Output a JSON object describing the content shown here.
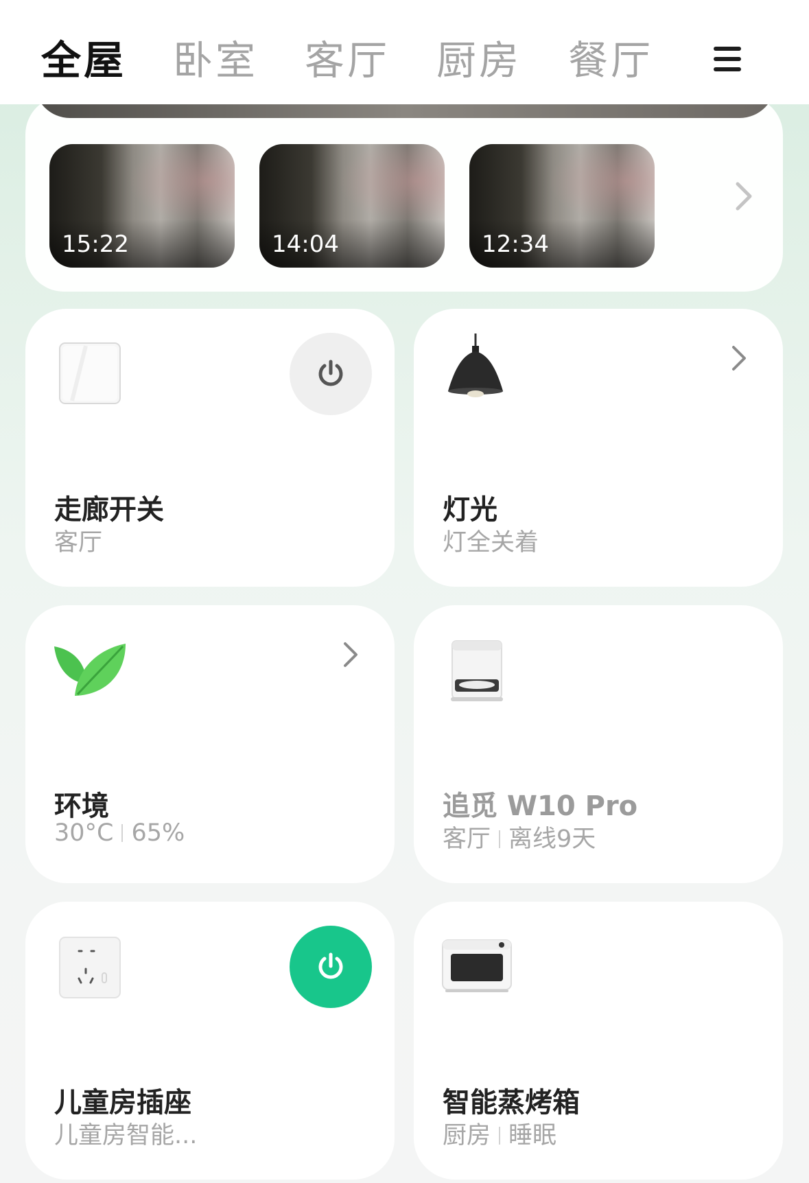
{
  "tabs": [
    {
      "label": "全屋",
      "active": true
    },
    {
      "label": "卧室",
      "active": false
    },
    {
      "label": "客厅",
      "active": false
    },
    {
      "label": "厨房",
      "active": false
    },
    {
      "label": "餐厅",
      "active": false
    }
  ],
  "menu_icon": "hamburger-menu-icon",
  "snapshots": [
    {
      "time": "15:22"
    },
    {
      "time": "14:04"
    },
    {
      "time": "12:34"
    }
  ],
  "devices": {
    "hallway_switch": {
      "name": "走廊开关",
      "room": "客厅",
      "icon": "wall-switch-icon",
      "power_state": "off"
    },
    "lights": {
      "name": "灯光",
      "status": "灯全关着",
      "icon": "pendant-lamp-icon"
    },
    "environment": {
      "name": "环境",
      "temperature": "30°C",
      "humidity": "65%",
      "icon": "leaf-icon"
    },
    "vacuum": {
      "name": "追觅 W10 Pro",
      "room": "客厅",
      "status": "离线9天",
      "icon": "robot-vacuum-station-icon"
    },
    "kids_socket": {
      "name": "儿童房插座",
      "sub": "儿童房智能...",
      "icon": "power-socket-icon",
      "power_state": "on"
    },
    "steam_oven": {
      "name": "智能蒸烤箱",
      "room": "厨房",
      "status": "睡眠",
      "icon": "steam-oven-icon"
    }
  },
  "colors": {
    "accent_on": "#18c68b",
    "power_off_bg": "#efefef",
    "tab_active": "#111111",
    "tab_inactive": "#a4a4a4"
  }
}
